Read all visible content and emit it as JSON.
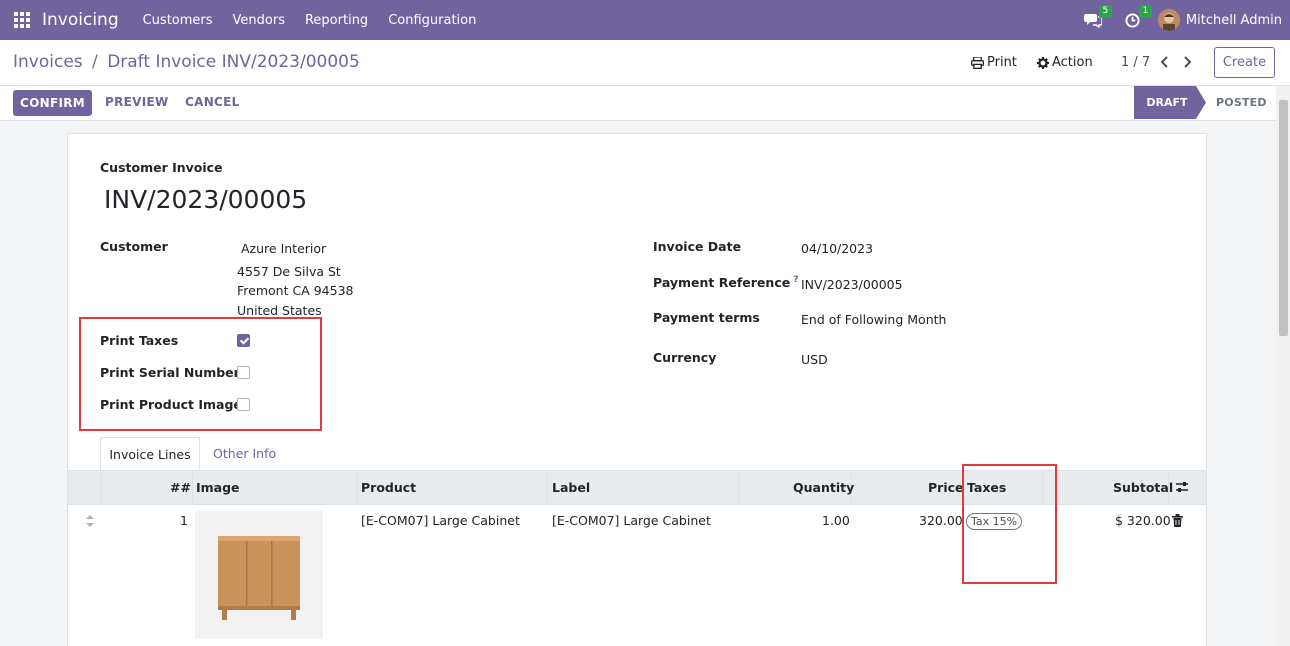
{
  "navbar": {
    "app_name": "Invoicing",
    "menu": [
      "Customers",
      "Vendors",
      "Reporting",
      "Configuration"
    ],
    "messages_badge": "5",
    "activities_badge": "1",
    "user_name": "Mitchell Admin"
  },
  "control_panel": {
    "breadcrumb_parent": "Invoices",
    "breadcrumb_sep": "/",
    "breadcrumb_current": "Draft Invoice INV/2023/00005",
    "print_label": "Print",
    "action_label": "Action",
    "pager": "1 / 7",
    "create_label": "Create"
  },
  "statusbar": {
    "confirm_label": "CONFIRM",
    "preview_label": "PREVIEW",
    "cancel_label": "CANCEL",
    "stage_draft": "DRAFT",
    "stage_posted": "POSTED"
  },
  "form": {
    "type_label": "Customer Invoice",
    "number": "INV/2023/00005",
    "customer_label": "Customer",
    "customer_name": "Azure Interior",
    "address_line1": "4557 De Silva St",
    "address_line2": "Fremont CA 94538",
    "address_line3": "United States",
    "print_taxes_label": "Print Taxes",
    "print_taxes_checked": true,
    "print_serial_label": "Print Serial Number",
    "print_serial_checked": false,
    "print_image_label": "Print Product Image",
    "print_image_checked": false,
    "invoice_date_label": "Invoice Date",
    "invoice_date": "04/10/2023",
    "payment_ref_label": "Payment Reference",
    "payment_ref_help": "?",
    "payment_ref": "INV/2023/00005",
    "payment_terms_label": "Payment terms",
    "payment_terms": "End of Following Month",
    "currency_label": "Currency",
    "currency": "USD"
  },
  "tabs": {
    "invoice_lines": "Invoice Lines",
    "other_info": "Other Info"
  },
  "table": {
    "headers": {
      "num": "##",
      "image": "Image",
      "product": "Product",
      "label": "Label",
      "quantity": "Quantity",
      "price": "Price",
      "taxes": "Taxes",
      "subtotal": "Subtotal"
    },
    "rows": [
      {
        "num": "1",
        "product": "[E-COM07] Large Cabinet",
        "label": "[E-COM07] Large Cabinet",
        "quantity": "1.00",
        "price": "320.00",
        "tax": "Tax 15%",
        "subtotal": "$ 320.00"
      }
    ]
  },
  "colors": {
    "brand": "#71639e",
    "highlight": "#e0393e"
  }
}
